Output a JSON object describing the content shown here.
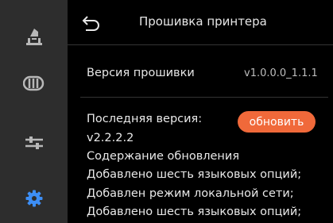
{
  "sidebar": {
    "items": [
      {
        "icon": "printer-icon",
        "active": false
      },
      {
        "icon": "filament-spool-icon",
        "active": false
      },
      {
        "icon": "sliders-icon",
        "active": false
      },
      {
        "icon": "gear-icon",
        "active": true
      }
    ],
    "colors": {
      "inactive": "#b8b8b8",
      "active": "#3d8ef5"
    }
  },
  "header": {
    "title": "Прошивка принтера"
  },
  "firmware": {
    "version_label": "Версия прошивки",
    "version_value": "v1.0.0.0_1.1.1"
  },
  "update": {
    "latest_label": "Последняя версия:",
    "latest_value": "v2.2.2.2",
    "button_label": "обновить",
    "changes_title": "Содержание обновления",
    "changes": [
      "Добавлено шесть языковых опций;",
      "Добавлен режим локальной сети;",
      "Добавлено шесть языковых опций;"
    ]
  },
  "colors": {
    "accent": "#f0693a",
    "sidebar_bg": "#2d2d2d",
    "background": "#000000"
  }
}
